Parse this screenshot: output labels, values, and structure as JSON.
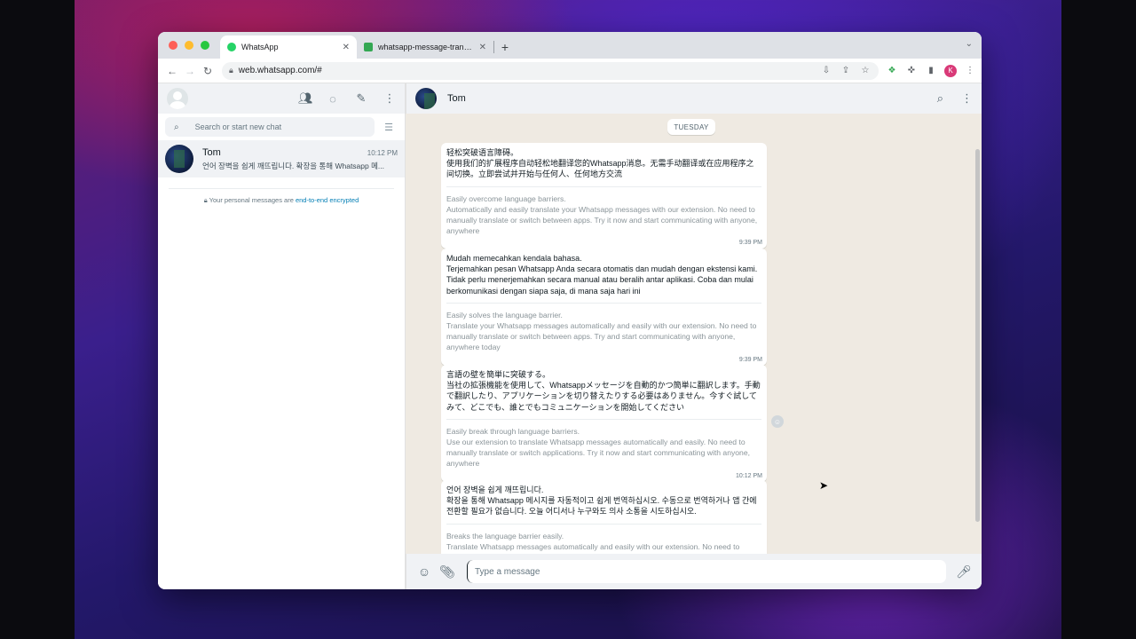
{
  "browser": {
    "tabs": [
      {
        "title": "WhatsApp",
        "close": "✕",
        "favicon_color": "#25d366"
      },
      {
        "title": "whatsapp-message-translator",
        "close": "✕",
        "favicon_color": "#34a853"
      }
    ],
    "new_tab": "+",
    "url": "web.whatsapp.com/#",
    "profile_initial": "K"
  },
  "sidebar": {
    "search_placeholder": "Search or start new chat",
    "chats": [
      {
        "name": "Tom",
        "time": "10:12 PM",
        "preview": "언어 장벽을 쉽게 깨뜨립니다. 확장을 통해 Whatsapp 메..."
      }
    ],
    "encryption_notice_prefix": "Your personal messages are ",
    "encryption_notice_link": "end-to-end encrypted"
  },
  "conversation": {
    "contact_name": "Tom",
    "date_chip": "TUESDAY",
    "messages": [
      {
        "original": "轻松突破语言障碍。\n使用我们的扩展程序自动轻松地翻译您的Whatsapp消息。无需手动翻译或在应用程序之间切换。立即尝试并开始与任何人、任何地方交流",
        "translation": "Easily overcome language barriers.\nAutomatically and easily translate your Whatsapp messages with our extension. No need to manually translate or switch between apps. Try it now and start communicating with anyone, anywhere",
        "time": "9:39 PM"
      },
      {
        "original": "Mudah memecahkan kendala bahasa.\nTerjemahkan pesan Whatsapp Anda secara otomatis dan mudah dengan ekstensi kami. Tidak perlu menerjemahkan secara manual atau beralih antar aplikasi. Coba dan mulai berkomunikasi dengan siapa saja, di mana saja hari ini",
        "translation": "Easily solves the language barrier.\nTranslate your Whatsapp messages automatically and easily with our extension. No need to manually translate or switch between apps. Try and start communicating with anyone, anywhere today",
        "time": "9:39 PM"
      },
      {
        "original": "言語の壁を簡単に突破する。\n当社の拡張機能を使用して、Whatsappメッセージを自動的かつ簡単に翻訳します。手動で翻訳したり、アプリケーションを切り替えたりする必要はありません。今すぐ試してみて、どこでも、誰とでもコミュニケーションを開始してください",
        "translation": "Easily break through language barriers.\nUse our extension to translate Whatsapp messages automatically and easily. No need to manually translate or switch applications. Try it now and start communicating with anyone, anywhere",
        "time": "10:12 PM"
      },
      {
        "original": "언어 장벽을 쉽게 깨뜨립니다.\n확장을 통해 Whatsapp 메시지를 자동적이고 쉽게 번역하십시오. 수동으로 번역하거나 앱 간에 전환할 필요가 없습니다. 오늘 어디서나 누구와도 의사 소통을 시도하십시오.",
        "translation": "Breaks the language barrier easily.\nTranslate Whatsapp messages automatically and easily with our extension. No need to manually translate or switch between apps. Try to communicate with anyone,",
        "time": ""
      }
    ],
    "composer_placeholder": "Type a message"
  }
}
